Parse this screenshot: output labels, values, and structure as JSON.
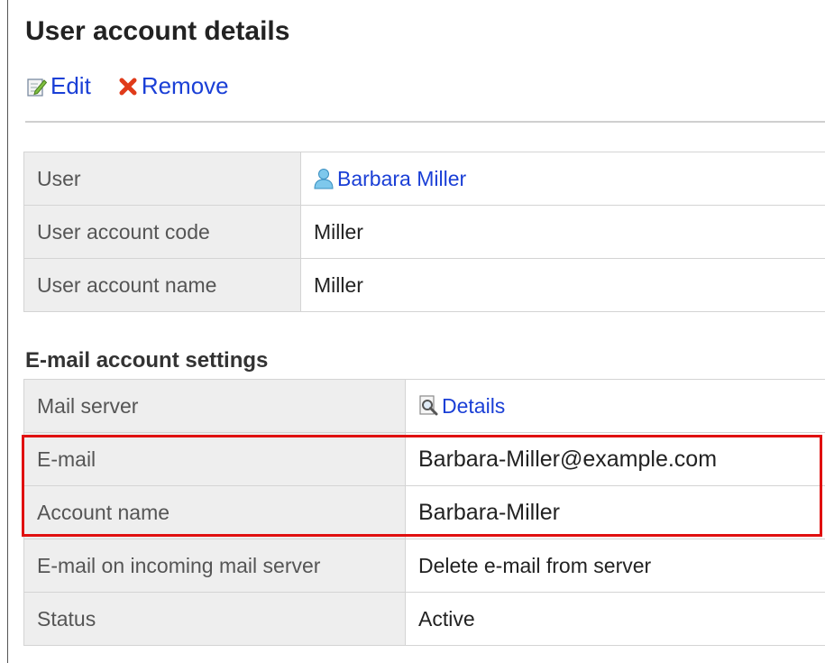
{
  "page": {
    "title": "User account details"
  },
  "toolbar": {
    "edit_label": "Edit",
    "remove_label": "Remove"
  },
  "user_info": {
    "rows": [
      {
        "label": "User",
        "value": "Barbara Miller"
      },
      {
        "label": "User account code",
        "value": "Miller"
      },
      {
        "label": "User account name",
        "value": "Miller"
      }
    ]
  },
  "email_settings": {
    "title": "E-mail account settings",
    "rows": [
      {
        "label": "Mail server",
        "value": "Details"
      },
      {
        "label": "E-mail",
        "value": "Barbara-Miller@example.com"
      },
      {
        "label": "Account name",
        "value": "Barbara-Miller"
      },
      {
        "label": "E-mail on incoming mail server",
        "value": "Delete e-mail from server"
      },
      {
        "label": "Status",
        "value": "Active"
      }
    ]
  },
  "colors": {
    "link": "#1a3fd6",
    "status_active": "#2e8b2e",
    "highlight": "#e01010"
  },
  "icons": {
    "edit": "edit-icon",
    "remove": "remove-icon",
    "user": "user-icon",
    "details": "magnifier-document-icon"
  }
}
